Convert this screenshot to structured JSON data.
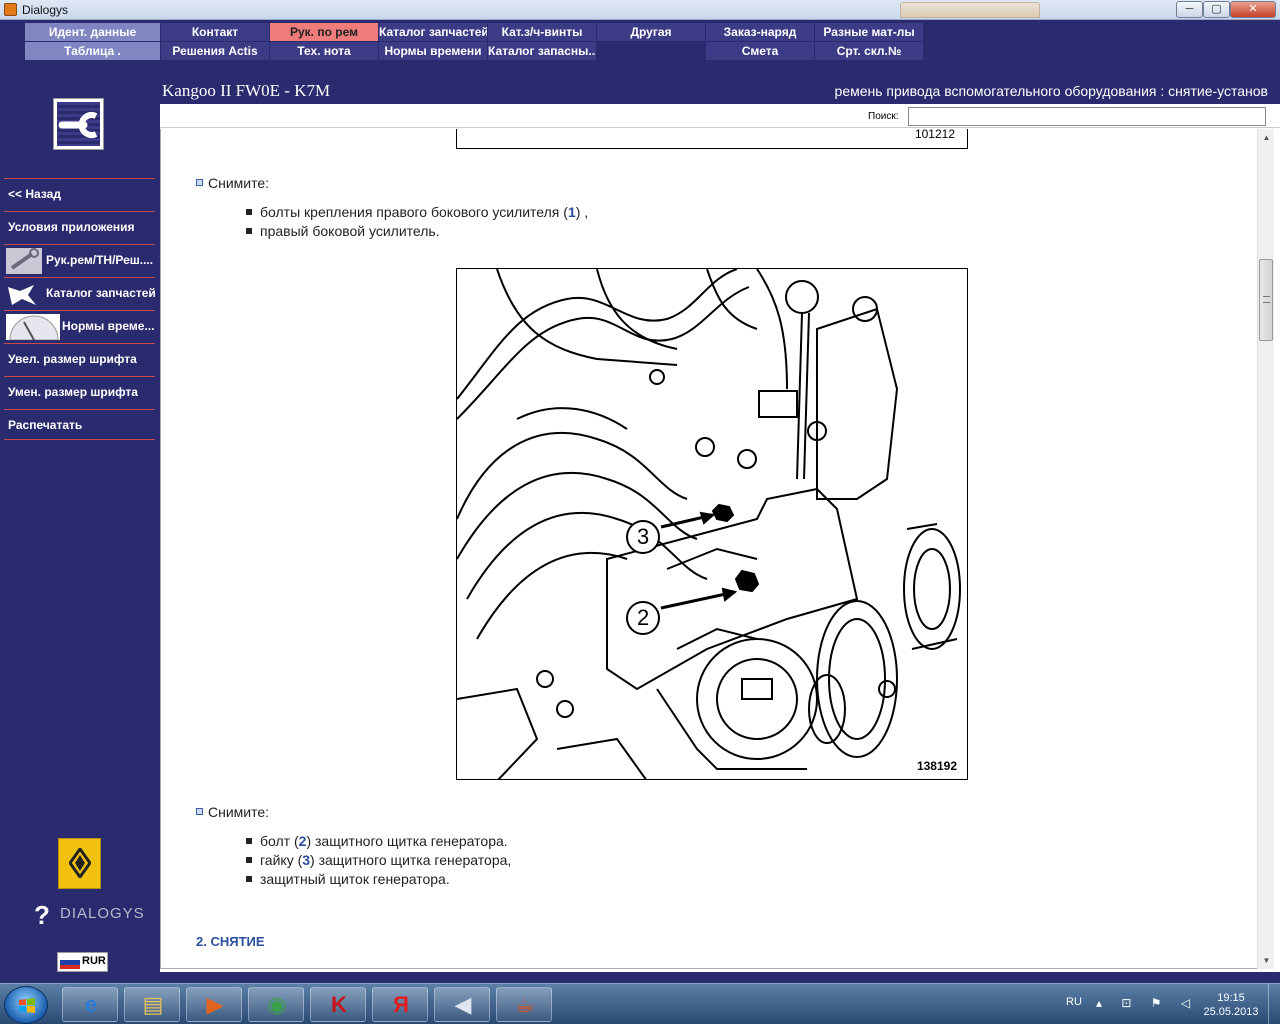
{
  "window": {
    "title": "Dialogys",
    "min_label": "─",
    "max_label": "▢",
    "close_label": "✕"
  },
  "topnav": {
    "row1": [
      {
        "label": "Идент. данные",
        "style": "light"
      },
      {
        "label": "Контакт",
        "style": "dark"
      },
      {
        "label": "Рук. по рем",
        "style": "active"
      },
      {
        "label": "Каталог запчастей",
        "style": "dark"
      },
      {
        "label": "Кат.з/ч-винты",
        "style": "dark"
      },
      {
        "label": "Другая",
        "style": "dark"
      },
      {
        "label": "Заказ-наряд",
        "style": "dark"
      },
      {
        "label": "Разные мат-лы",
        "style": "dark"
      }
    ],
    "row2": [
      {
        "label": "Таблица .",
        "style": "light"
      },
      {
        "label": "Решения Actis",
        "style": "dark"
      },
      {
        "label": "Тех. нота",
        "style": "dark"
      },
      {
        "label": "Нормы времени",
        "style": "dark"
      },
      {
        "label": "Каталог запасны...",
        "style": "dark"
      },
      {
        "label": "Смета",
        "style": "dark"
      },
      {
        "label": "Срт. скл.№",
        "style": "dark"
      }
    ]
  },
  "header": {
    "model": "Kangoo II FW0E - K7M",
    "doc_title": "ремень привода вспомогательного оборудования : снятие-установ"
  },
  "sidebar": {
    "items": [
      {
        "label": "<< Назад"
      },
      {
        "label": "Условия приложения"
      },
      {
        "label": "Рук.рем/ТН/Реш...."
      },
      {
        "label": "Каталог запчастей"
      },
      {
        "label": "Нормы време..."
      },
      {
        "label": "Увел. размер шрифта"
      },
      {
        "label": "Умен. размер шрифта"
      },
      {
        "label": "Распечатать"
      }
    ],
    "brand_text": "DIALOGYS",
    "brand_mark": "?",
    "currency": "RUR"
  },
  "search": {
    "label": "Поиск:",
    "value": ""
  },
  "document": {
    "prev_figure_code": "101212",
    "step1": {
      "heading": "Снимите:",
      "items": [
        {
          "before": "болты крепления правого бокового усилителя (",
          "ref": "1",
          "after": ") ,"
        },
        {
          "before": "правый боковой усилитель.",
          "ref": "",
          "after": ""
        }
      ]
    },
    "figure": {
      "code": "138192",
      "callouts": [
        "3",
        "2"
      ]
    },
    "step2": {
      "heading": "Снимите:",
      "items": [
        {
          "before": "болт (",
          "ref": "2",
          "after": ") защитного щитка генератора."
        },
        {
          "before": "гайку (",
          "ref": "3",
          "after": ") защитного щитка генератора,"
        },
        {
          "before": "защитный щиток генератора.",
          "ref": "",
          "after": ""
        }
      ]
    },
    "section_heading": "2. СНЯТИЕ"
  },
  "taskbar": {
    "apps": [
      {
        "name": "internet-explorer",
        "glyph": "e",
        "color": "#2a7bd4"
      },
      {
        "name": "file-explorer",
        "glyph": "▤",
        "color": "#e6c25a"
      },
      {
        "name": "media-player",
        "glyph": "▶",
        "color": "#e3641d"
      },
      {
        "name": "chrome",
        "glyph": "◉",
        "color": "#3aa04a"
      },
      {
        "name": "kaspersky",
        "glyph": "K",
        "color": "#c4161c"
      },
      {
        "name": "yandex",
        "glyph": "Я",
        "color": "#e11d1d"
      },
      {
        "name": "sound",
        "glyph": "◀",
        "color": "#dfe6f0"
      },
      {
        "name": "java",
        "glyph": "☕",
        "color": "#d9541e"
      }
    ],
    "language": "RU",
    "tray_icons": "▴ ⊡ ⚑ ◁",
    "time": "19:15",
    "date": "25.05.2013"
  },
  "colors": {
    "accent": "#2a2a6e",
    "active_tab": "#f07b7b",
    "link_ref": "#2a4f9c",
    "separator": "#c94a4a"
  }
}
